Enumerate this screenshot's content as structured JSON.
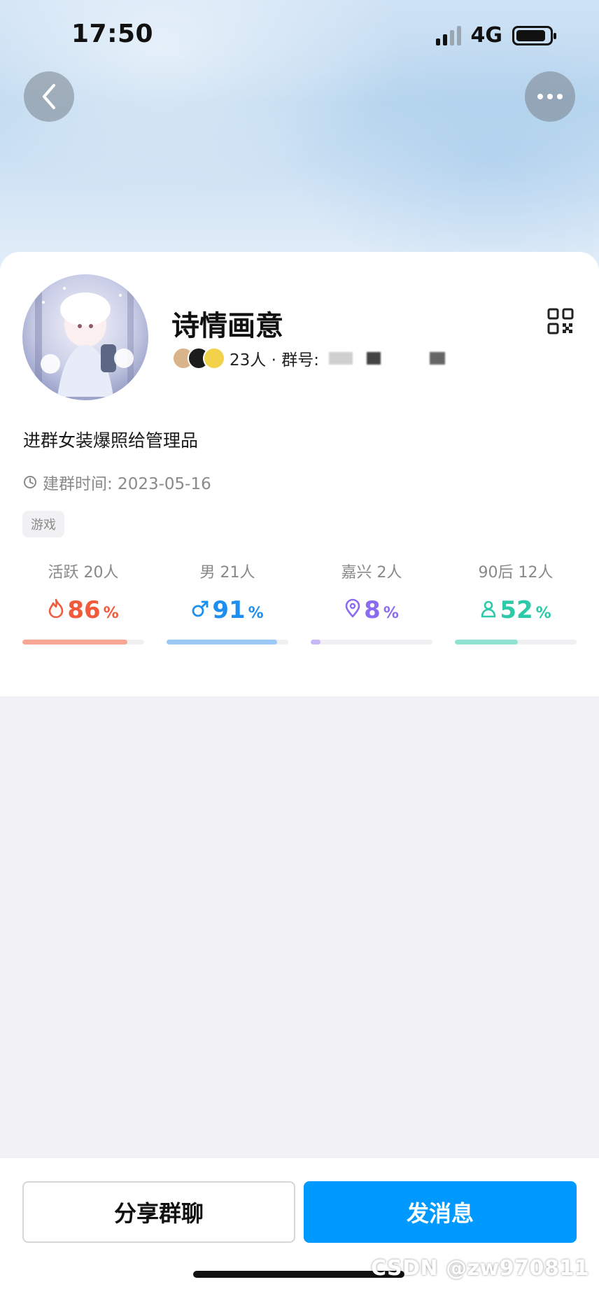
{
  "status_bar": {
    "time": "17:50",
    "network": "4G"
  },
  "group": {
    "name": "诗情画意",
    "member_count": "23人 · 群号:",
    "description": "进群女装爆照给管理品",
    "created": "建群时间: 2023-05-16",
    "tag": "游戏"
  },
  "stats": [
    {
      "label": "活跃 20人",
      "value": "86",
      "unit": "%",
      "fraction": 0.86,
      "color": "#f25a3c",
      "bar_color": "#f8a594",
      "icon": "flame-icon"
    },
    {
      "label": "男 21人",
      "value": "91",
      "unit": "%",
      "fraction": 0.91,
      "color": "#1d8ff0",
      "bar_color": "#9cc8f7",
      "icon": "male-icon"
    },
    {
      "label": "嘉兴 2人",
      "value": "8",
      "unit": "%",
      "fraction": 0.08,
      "color": "#8b6cf0",
      "bar_color": "#c6b8f6",
      "icon": "location-pin-icon"
    },
    {
      "label": "90后 12人",
      "value": "52",
      "unit": "%",
      "fraction": 0.52,
      "color": "#2ccaa8",
      "bar_color": "#8fe3d2",
      "icon": "person-icon"
    }
  ],
  "actions": {
    "share": "分享群聊",
    "send": "发消息"
  },
  "watermark": "CSDN @zw970811"
}
